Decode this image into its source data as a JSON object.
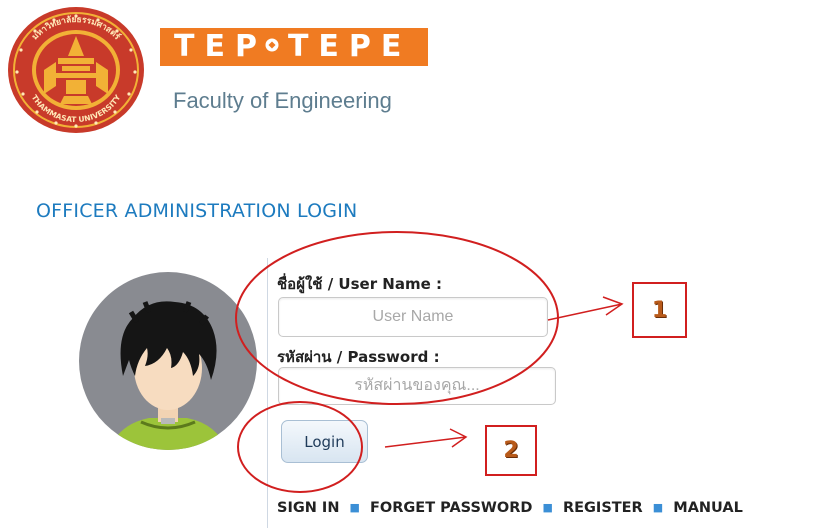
{
  "header": {
    "seal_text": "มหาวิทยาลัยธรรมศาสตร์ • THAMMASAT UNIVERSITY",
    "banner_left": "TEP",
    "banner_right": "TEPE",
    "faculty": "Faculty of Engineering",
    "colors": {
      "banner": "#f07b22",
      "seal": "#c83a2a",
      "seal_gold": "#f2b136"
    }
  },
  "login": {
    "heading": "OFFICER ADMINISTRATION LOGIN",
    "username_label": "ชื่อผู้ใช้ / User Name :",
    "username_placeholder": "User Name",
    "password_label": "รหัสผ่าน / Password :",
    "password_placeholder": "รหัสผ่านของคุณ...",
    "login_button": "Login"
  },
  "bottom_nav": {
    "items": [
      "SIGN IN",
      "FORGET PASSWORD",
      "REGISTER",
      "MANUAL"
    ],
    "separator_color": "#3b8fd6"
  },
  "annotations": {
    "step_1": "1",
    "step_2": "2",
    "color": "#d11f1f"
  },
  "avatar": {
    "icon": "user-avatar-icon"
  }
}
